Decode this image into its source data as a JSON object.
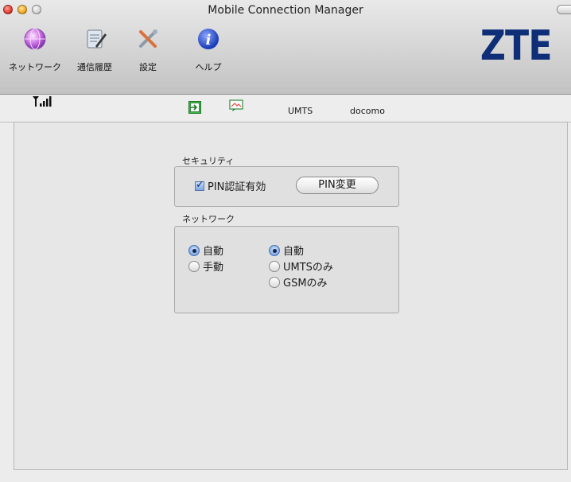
{
  "window": {
    "title": "Mobile Connection Manager"
  },
  "toolbar": {
    "items": [
      {
        "label": "ネットワーク",
        "icon": "network-globe-icon"
      },
      {
        "label": "通信履歴",
        "icon": "history-notepad-icon"
      },
      {
        "label": "設定",
        "icon": "settings-tools-icon"
      },
      {
        "label": "ヘルプ",
        "icon": "help-info-icon"
      }
    ],
    "logo": "ZTE"
  },
  "statusbar": {
    "signal_icon": "signal-strength-icon",
    "connect_icon": "connection-status-icon",
    "message_icon": "sms-icon",
    "network_type": "UMTS",
    "carrier": "docomo"
  },
  "security": {
    "section_label": "セキュリティ",
    "pin_enabled_label": "PIN認証有効",
    "pin_enabled": true,
    "change_pin_button": "PIN変更"
  },
  "network": {
    "section_label": "ネットワーク",
    "selection_mode": {
      "options": [
        "自動",
        "手動"
      ],
      "selected": "自動"
    },
    "network_type": {
      "options": [
        "自動",
        "UMTSのみ",
        "GSMのみ"
      ],
      "selected": "自動"
    }
  },
  "colors": {
    "logo": "#0f2e78",
    "radio_selected": "#7aa6e3",
    "window_bg": "#ececec"
  }
}
